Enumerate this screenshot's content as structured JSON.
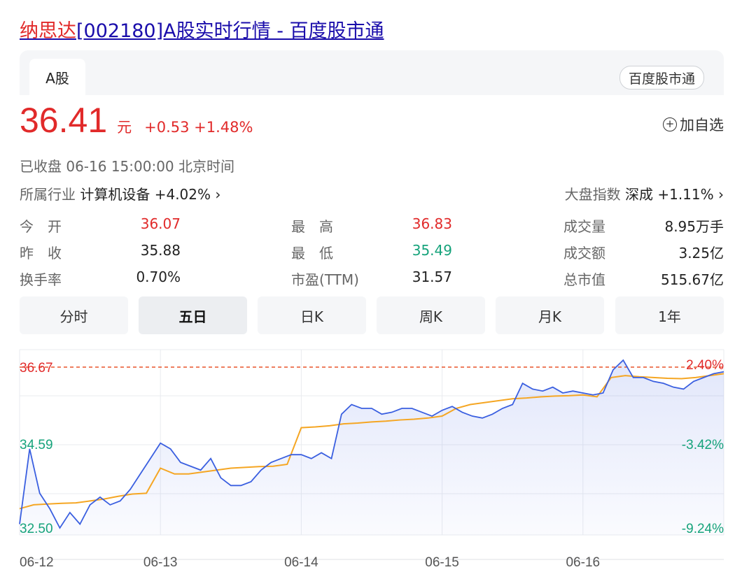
{
  "header": {
    "title_highlight": "纳思达",
    "title_rest": "[002180]A股实时行情 - 百度股市通"
  },
  "tabs": {
    "active": "A股",
    "source": "百度股市通"
  },
  "quote": {
    "price": "36.41",
    "unit": "元",
    "change": "+0.53 +1.48%",
    "add_watch": "加自选",
    "status": "已收盘  06-16 15:00:00  北京时间"
  },
  "industry": {
    "label": "所属行业",
    "value": "计算机设备 +4.02% ›"
  },
  "index": {
    "label": "大盘指数",
    "value": "深成 +1.11% ›"
  },
  "stats": {
    "open_label": "今　开",
    "open": "36.07",
    "high_label": "最　高",
    "high": "36.83",
    "volume_label": "成交量",
    "volume": "8.95万手",
    "prev_close_label": "昨　收",
    "prev_close": "35.88",
    "low_label": "最　低",
    "low": "35.49",
    "amount_label": "成交额",
    "amount": "3.25亿",
    "turnover_label": "换手率",
    "turnover": "0.70%",
    "pe_label": "市盈(TTM)",
    "pe": "31.57",
    "mktcap_label": "总市值",
    "mktcap": "515.67亿"
  },
  "periods": [
    "分时",
    "五日",
    "日K",
    "周K",
    "月K",
    "1年"
  ],
  "active_period": "五日",
  "colors": {
    "up": "#e12a2a",
    "down": "#16a37b",
    "price_line": "#3a5fe0",
    "avg_line": "#f5a623",
    "link": "#1a0dab"
  },
  "chart_data": {
    "type": "line",
    "y_left_ticks": [
      "36.67",
      "34.59",
      "32.50"
    ],
    "y_right_ticks": [
      "2.40%",
      "-3.42%",
      "-9.24%"
    ],
    "x_labels": [
      "06-12",
      "06-13",
      "06-14",
      "06-15",
      "06-16"
    ],
    "ylim": [
      32.5,
      36.67
    ],
    "reference_line": 36.67,
    "series": [
      {
        "values": [
          32.6,
          34.55,
          33.4,
          33.0,
          32.5,
          32.9,
          32.6,
          33.1,
          33.3,
          33.1,
          33.2,
          33.5,
          33.9,
          34.3,
          34.7,
          34.55,
          34.2,
          34.1,
          34.0,
          34.3,
          33.8,
          33.6,
          33.6,
          33.7,
          34.0,
          34.2,
          34.3,
          34.4,
          34.4,
          34.3,
          34.45,
          34.3,
          35.45,
          35.7,
          35.6,
          35.6,
          35.45,
          35.5,
          35.6,
          35.6,
          35.5,
          35.4,
          35.55,
          35.65,
          35.5,
          35.4,
          35.35,
          35.45,
          35.6,
          35.7,
          36.25,
          36.1,
          36.05,
          36.15,
          36.0,
          36.05,
          36.0,
          35.95,
          36.0,
          36.6,
          36.85,
          36.4,
          36.4,
          36.3,
          36.25,
          36.15,
          36.1,
          36.3,
          36.4,
          36.5,
          36.55
        ]
      },
      {
        "values": [
          33.0,
          33.1,
          33.12,
          33.14,
          33.15,
          33.2,
          33.25,
          33.32,
          33.38,
          33.4,
          34.05,
          33.9,
          33.9,
          33.95,
          34.0,
          34.05,
          34.07,
          34.09,
          34.1,
          34.15,
          35.1,
          35.12,
          35.15,
          35.2,
          35.22,
          35.25,
          35.27,
          35.3,
          35.32,
          35.35,
          35.4,
          35.6,
          35.7,
          35.75,
          35.8,
          35.85,
          35.87,
          35.9,
          35.92,
          35.93,
          35.95,
          35.9,
          36.4,
          36.45,
          36.42,
          36.4,
          36.38,
          36.37,
          36.4,
          36.45,
          36.5
        ]
      }
    ]
  }
}
